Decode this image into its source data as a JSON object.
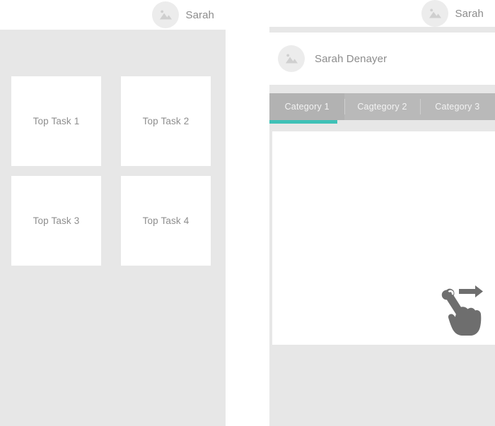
{
  "left_panel": {
    "topbar": {
      "user_name": "Sarah",
      "avatar_icon": "image-placeholder-icon"
    },
    "tasks": [
      {
        "label": "Top Task 1"
      },
      {
        "label": "Top Task 2"
      },
      {
        "label": "Top Task 3"
      },
      {
        "label": "Top Task 4"
      }
    ]
  },
  "right_panel": {
    "topbar": {
      "user_name": "Sarah",
      "avatar_icon": "image-placeholder-icon"
    },
    "profile": {
      "name": "Sarah Denayer",
      "avatar_icon": "image-placeholder-icon"
    },
    "tabs": [
      {
        "label": "Category 1",
        "active": true
      },
      {
        "label": "Cagtegory 2",
        "active": false
      },
      {
        "label": "Category 3",
        "active": false
      }
    ],
    "content": {
      "gesture_icon": "swipe-right-hand-icon"
    }
  },
  "colors": {
    "accent": "#3fc1b7",
    "panel_bg": "#e7e7e7",
    "card_bg": "#ffffff",
    "tabbar_bg": "#b9b9b9",
    "text_muted": "#8c8c8c",
    "icon_gray": "#6e6e6e"
  }
}
